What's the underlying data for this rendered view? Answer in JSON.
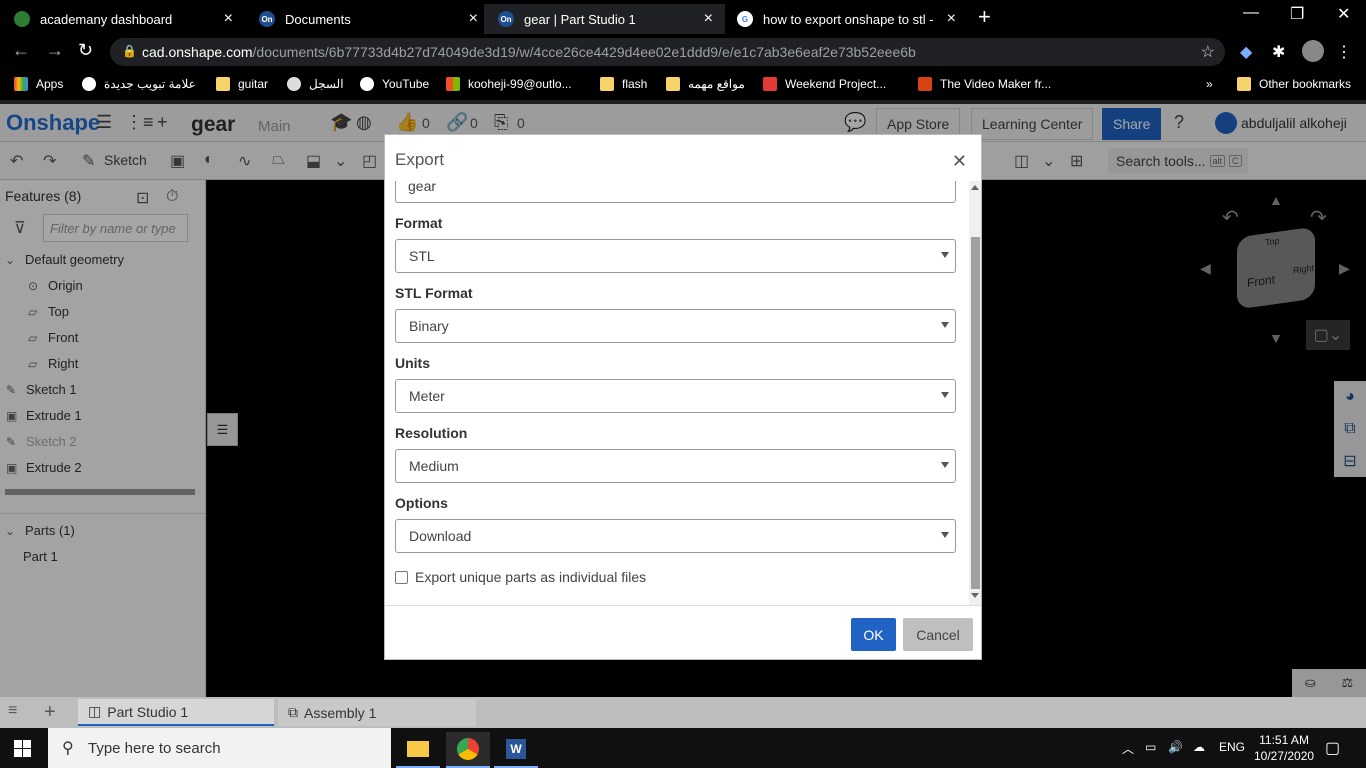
{
  "browser": {
    "tabs": [
      {
        "title": "academany dashboard",
        "color": "#2e7d32"
      },
      {
        "title": "Documents",
        "color": "#1f4f90"
      },
      {
        "title": "gear | Part Studio 1",
        "color": "#1f4f90"
      },
      {
        "title": "how to export onshape to stl - G",
        "color": "#ffffff"
      }
    ],
    "url_domain": "cad.onshape.com",
    "url_path": "/documents/6b77733d4b27d74049de3d19/w/4cce26ce4429d4ee02e1ddd9/e/e1c7ab3e6eaf2e73b52eee6b",
    "bookmarks": [
      {
        "label": "Apps"
      },
      {
        "label": "علامة تبويب جديدة"
      },
      {
        "label": "guitar"
      },
      {
        "label": "السجل"
      },
      {
        "label": "YouTube"
      },
      {
        "label": "kooheji-99@outlo..."
      },
      {
        "label": "flash"
      },
      {
        "label": "مواقع مهمه"
      },
      {
        "label": "Weekend Project..."
      },
      {
        "label": "The Video Maker fr..."
      },
      {
        "label": "Other bookmarks"
      }
    ],
    "overflow": "»"
  },
  "onshape": {
    "logo": "Onshape",
    "doc_name": "gear",
    "branch": "Main",
    "likes": "0",
    "links": "0",
    "copies": "0",
    "app_store": "App Store",
    "learning_center": "Learning Center",
    "share": "Share",
    "user_name": "abduljalil alkoheji",
    "sketch": "Sketch",
    "search_tools": "Search tools...",
    "search_kbd1": "alt",
    "search_kbd2": "C"
  },
  "features": {
    "title": "Features (8)",
    "filter_placeholder": "Filter by name or type",
    "default_geometry": "Default geometry",
    "items": [
      {
        "label": "Origin"
      },
      {
        "label": "Top"
      },
      {
        "label": "Front"
      },
      {
        "label": "Right"
      },
      {
        "label": "Sketch 1"
      },
      {
        "label": "Extrude 1"
      },
      {
        "label": "Sketch 2"
      },
      {
        "label": "Extrude 2"
      }
    ],
    "parts_title": "Parts (1)",
    "parts": [
      {
        "label": "Part 1"
      }
    ]
  },
  "viewcube": {
    "top": "Top",
    "front": "Front",
    "right": "Right"
  },
  "bottom_tabs": [
    {
      "label": "Part Studio 1"
    },
    {
      "label": "Assembly 1"
    }
  ],
  "dialog": {
    "title": "Export",
    "name_value": "gear",
    "format_label": "Format",
    "format_value": "STL",
    "stl_format_label": "STL Format",
    "stl_format_value": "Binary",
    "units_label": "Units",
    "units_value": "Meter",
    "resolution_label": "Resolution",
    "resolution_value": "Medium",
    "options_label": "Options",
    "options_value": "Download",
    "unique_parts_label": "Export unique parts as individual files",
    "unique_parts_checked": false,
    "ok": "OK",
    "cancel": "Cancel"
  },
  "taskbar": {
    "search_placeholder": "Type here to search",
    "lang": "ENG",
    "time": "11:51 AM",
    "date": "10/27/2020"
  },
  "colors": {
    "accent": "#2063c4",
    "onshape_blue": "#1f6ed1"
  }
}
